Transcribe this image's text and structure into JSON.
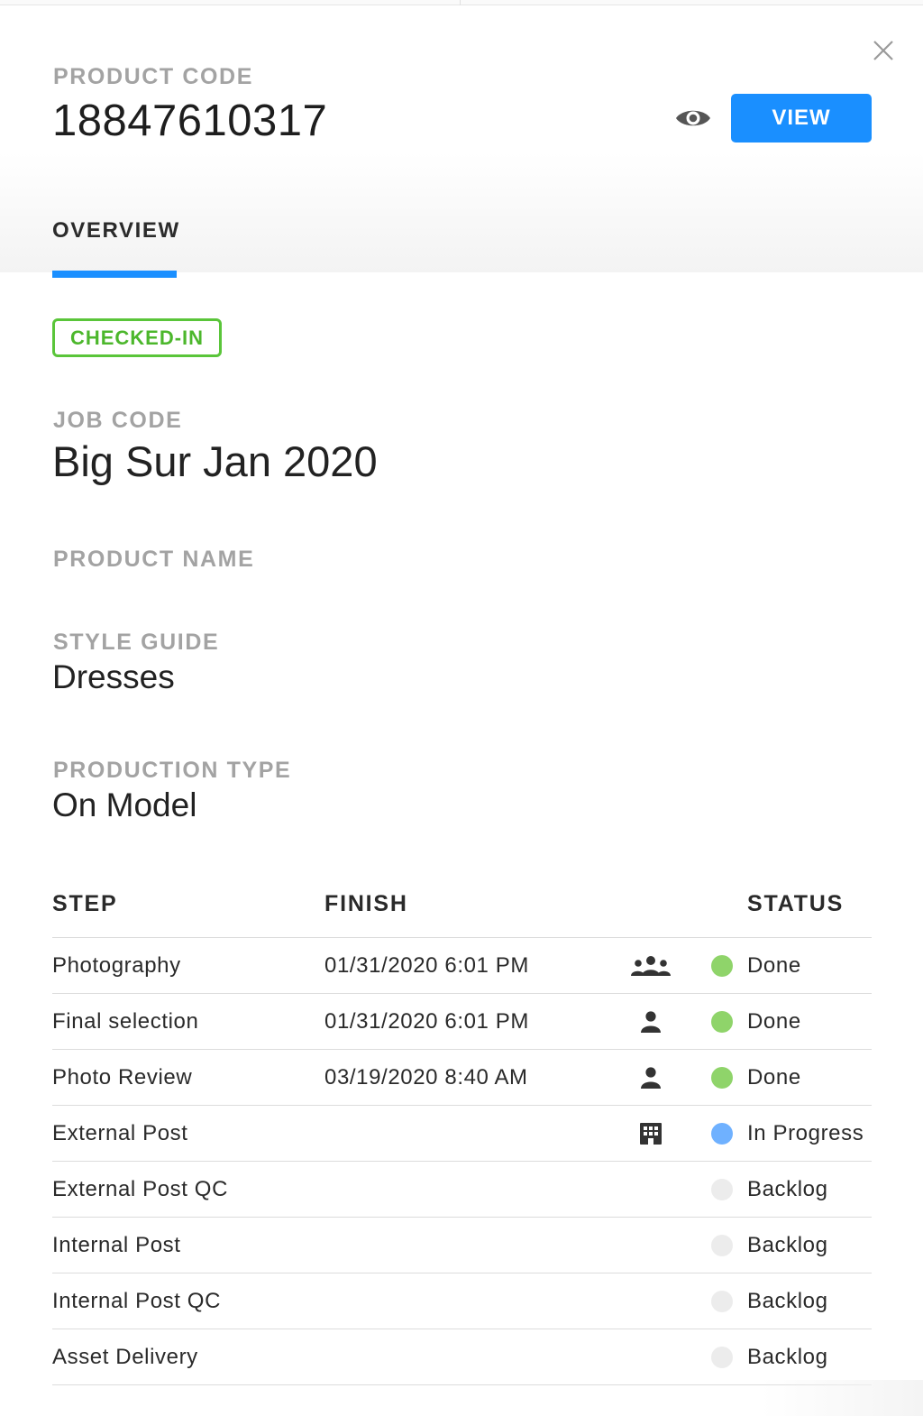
{
  "header": {
    "product_code_label": "PRODUCT CODE",
    "product_code_value": "18847610317",
    "view_button": "VIEW",
    "tab_overview": "OVERVIEW"
  },
  "status_badge": "CHECKED-IN",
  "fields": {
    "job_code_label": "JOB CODE",
    "job_code_value": "Big Sur Jan 2020",
    "product_name_label": "PRODUCT NAME",
    "style_guide_label": "STYLE GUIDE",
    "style_guide_value": "Dresses",
    "production_type_label": "PRODUCTION TYPE",
    "production_type_value": "On Model"
  },
  "steps_table": {
    "columns": {
      "step": "STEP",
      "finish": "FINISH",
      "status": "STATUS"
    },
    "rows": [
      {
        "step": "Photography",
        "finish": "01/31/2020 6:01 PM",
        "icon": "group-icon",
        "status": "Done",
        "status_color": "#8fd46a"
      },
      {
        "step": "Final selection",
        "finish": "01/31/2020 6:01 PM",
        "icon": "person-icon",
        "status": "Done",
        "status_color": "#8fd46a"
      },
      {
        "step": "Photo Review",
        "finish": "03/19/2020 8:40 AM",
        "icon": "person-icon",
        "status": "Done",
        "status_color": "#8fd46a"
      },
      {
        "step": "External Post",
        "finish": "",
        "icon": "building-icon",
        "status": "In Progress",
        "status_color": "#6fb1ff"
      },
      {
        "step": "External Post QC",
        "finish": "",
        "icon": "",
        "status": "Backlog",
        "status_color": "#ececec"
      },
      {
        "step": "Internal Post",
        "finish": "",
        "icon": "",
        "status": "Backlog",
        "status_color": "#ececec"
      },
      {
        "step": "Internal Post QC",
        "finish": "",
        "icon": "",
        "status": "Backlog",
        "status_color": "#ececec"
      },
      {
        "step": "Asset Delivery",
        "finish": "",
        "icon": "",
        "status": "Backlog",
        "status_color": "#ececec"
      }
    ]
  },
  "colors": {
    "accent": "#1a8fff",
    "checked_in": "#5ac53a",
    "done": "#8fd46a",
    "in_progress": "#6fb1ff",
    "backlog": "#ececec"
  }
}
